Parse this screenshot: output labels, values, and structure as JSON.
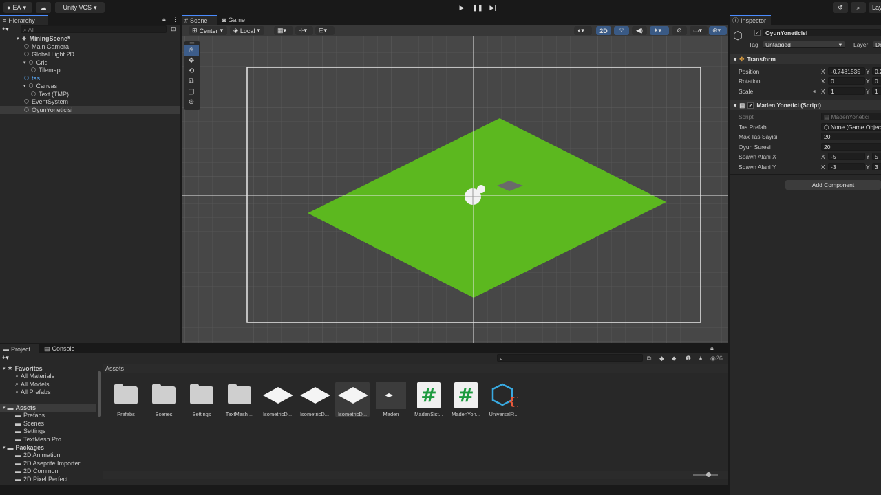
{
  "toolbar": {
    "account": "EA",
    "vcs": "Unity VCS",
    "layout": "Lay"
  },
  "hierarchy": {
    "tab": "Hierarchy",
    "search_placeholder": "All",
    "items": [
      {
        "label": "MiningScene*",
        "indent": 0,
        "icon": "unity-scene-icon"
      },
      {
        "label": "Main Camera",
        "indent": 1,
        "icon": "cube-icon"
      },
      {
        "label": "Global Light 2D",
        "indent": 1,
        "icon": "cube-icon"
      },
      {
        "label": "Grid",
        "indent": 1,
        "icon": "cube-icon"
      },
      {
        "label": "Tilemap",
        "indent": 2,
        "icon": "cube-icon"
      },
      {
        "label": "tas",
        "indent": 1,
        "icon": "prefab-icon"
      },
      {
        "label": "Canvas",
        "indent": 1,
        "icon": "cube-icon"
      },
      {
        "label": "Text (TMP)",
        "indent": 2,
        "icon": "cube-icon"
      },
      {
        "label": "EventSystem",
        "indent": 1,
        "icon": "cube-icon"
      },
      {
        "label": "OyunYoneticisi",
        "indent": 1,
        "icon": "cube-icon"
      }
    ]
  },
  "scene": {
    "tabs": [
      "Scene",
      "Game"
    ],
    "pivot": "Center",
    "space": "Local",
    "mode_2d": "2D",
    "ground_color": "#5cb81f"
  },
  "inspector": {
    "tab": "Inspector",
    "object_name": "OyunYoneticisi",
    "tag_label": "Tag",
    "tag_value": "Untagged",
    "layer_label": "Layer",
    "layer_value": "De",
    "transform": {
      "title": "Transform",
      "position_label": "Position",
      "position_x": "-0.7481535",
      "position_y": "0.2",
      "rotation_label": "Rotation",
      "rotation_x": "0",
      "rotation_y": "0",
      "scale_label": "Scale",
      "scale_x": "1",
      "scale_y": "1"
    },
    "script_component": {
      "title": "Maden Yonetici (Script)",
      "script_label": "Script",
      "script_value": "MadenYonetici",
      "tas_prefab_label": "Tas Prefab",
      "tas_prefab_value": "None (Game Objec",
      "max_tas_label": "Max Tas Sayisi",
      "max_tas_value": "20",
      "oyun_suresi_label": "Oyun Suresi",
      "oyun_suresi_value": "20",
      "spawn_x_label": "Spawn Alani X",
      "spawn_x_x": "-5",
      "spawn_x_y": "5",
      "spawn_y_label": "Spawn Alani Y",
      "spawn_y_x": "-3",
      "spawn_y_y": "3"
    },
    "add_component": "Add Component"
  },
  "project": {
    "tabs": [
      "Project",
      "Console"
    ],
    "count": "26",
    "breadcrumb": "Assets",
    "favorites_header": "Favorites",
    "favorites": [
      "All Materials",
      "All Models",
      "All Prefabs"
    ],
    "assets_header": "Assets",
    "assets_tree": [
      "Prefabs",
      "Scenes",
      "Settings",
      "TextMesh Pro"
    ],
    "packages_header": "Packages",
    "packages": [
      "2D Animation",
      "2D Aseprite Importer",
      "2D Common",
      "2D Pixel Perfect"
    ],
    "assets": [
      {
        "label": "Prefabs",
        "kind": "folder"
      },
      {
        "label": "Scenes",
        "kind": "folder"
      },
      {
        "label": "Settings",
        "kind": "folder"
      },
      {
        "label": "TextMesh ...",
        "kind": "folder"
      },
      {
        "label": "IsometricD...",
        "kind": "tile"
      },
      {
        "label": "IsometricD...",
        "kind": "tile"
      },
      {
        "label": "IsometricD...",
        "kind": "tile"
      },
      {
        "label": "Maden",
        "kind": "prefab"
      },
      {
        "label": "MadenSist...",
        "kind": "script"
      },
      {
        "label": "MadenYon...",
        "kind": "script"
      },
      {
        "label": "UniversalR...",
        "kind": "asset"
      }
    ]
  }
}
